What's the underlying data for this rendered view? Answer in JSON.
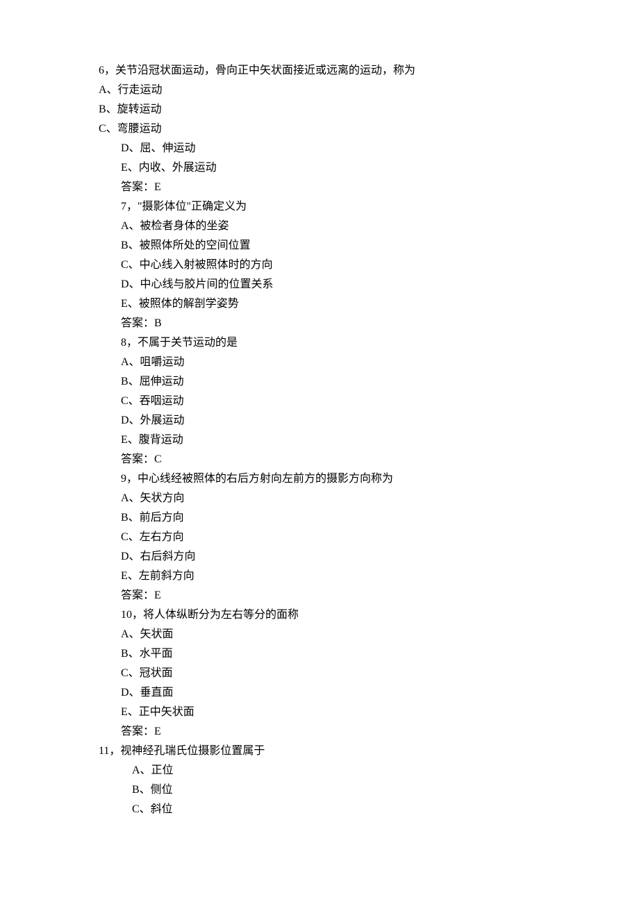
{
  "lines": [
    {
      "indent": "indent0",
      "text": "6，关节沿冠状面运动，骨向正中矢状面接近或远离的运动，称为"
    },
    {
      "indent": "indent0",
      "text": "A、行走运动"
    },
    {
      "indent": "indent0",
      "text": "B、旋转运动"
    },
    {
      "indent": "indent0",
      "text": "C、弯腰运动"
    },
    {
      "indent": "indent1",
      "text": "D、屈、伸运动"
    },
    {
      "indent": "indent1",
      "text": "E、内收、外展运动"
    },
    {
      "indent": "indent1",
      "text": "答案：E"
    },
    {
      "indent": "indent1",
      "text": "7，\"摄影体位\"正确定义为"
    },
    {
      "indent": "indent1",
      "text": "A、被检者身体的坐姿"
    },
    {
      "indent": "indent1",
      "text": "B、被照体所处的空间位置"
    },
    {
      "indent": "indent1",
      "text": "C、中心线入射被照体时的方向"
    },
    {
      "indent": "indent1",
      "text": "D、中心线与胶片间的位置关系"
    },
    {
      "indent": "indent1",
      "text": "E、被照体的解剖学姿势"
    },
    {
      "indent": "indent1",
      "text": "答案：B"
    },
    {
      "indent": "indent1",
      "text": "8，不属于关节运动的是"
    },
    {
      "indent": "indent1",
      "text": "A、咀嚼运动"
    },
    {
      "indent": "indent1",
      "text": "B、屈伸运动"
    },
    {
      "indent": "indent1",
      "text": "C、吞咽运动"
    },
    {
      "indent": "indent1",
      "text": "D、外展运动"
    },
    {
      "indent": "indent1",
      "text": "E、腹背运动"
    },
    {
      "indent": "indent1",
      "text": "答案：C"
    },
    {
      "indent": "indent1",
      "text": "9，中心线经被照体的右后方射向左前方的摄影方向称为"
    },
    {
      "indent": "indent1",
      "text": "A、矢状方向"
    },
    {
      "indent": "indent1",
      "text": "B、前后方向"
    },
    {
      "indent": "indent1",
      "text": "C、左右方向"
    },
    {
      "indent": "indent1",
      "text": "D、右后斜方向"
    },
    {
      "indent": "indent1",
      "text": "E、左前斜方向"
    },
    {
      "indent": "indent1",
      "text": "答案：E"
    },
    {
      "indent": "indent1",
      "text": "10，将人体纵断分为左右等分的面称"
    },
    {
      "indent": "indent1",
      "text": "A、矢状面"
    },
    {
      "indent": "indent1",
      "text": "B、水平面"
    },
    {
      "indent": "indent1",
      "text": "C、冠状面"
    },
    {
      "indent": "indent1",
      "text": "D、垂直面"
    },
    {
      "indent": "indent1",
      "text": "E、正中矢状面"
    },
    {
      "indent": "indent1",
      "text": "答案：E"
    },
    {
      "indent": "indent1",
      "text": ""
    },
    {
      "indent": "indent0",
      "text": "11，视神经孔瑞氏位摄影位置属于"
    },
    {
      "indent": "indent2",
      "text": "A、正位"
    },
    {
      "indent": "indent2",
      "text": "B、侧位"
    },
    {
      "indent": "indent2",
      "text": "C、斜位"
    }
  ]
}
